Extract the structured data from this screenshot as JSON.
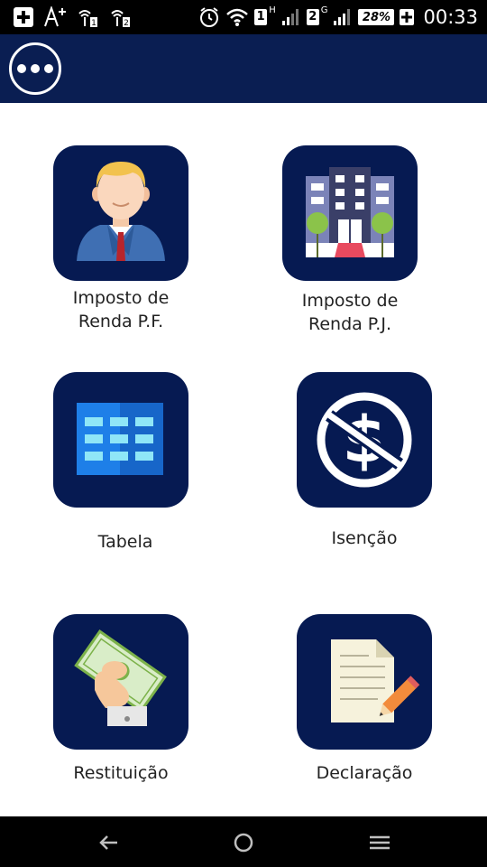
{
  "status_bar": {
    "sim1": "1",
    "sim1_network": "H",
    "sim2": "2",
    "sim2_network": "G",
    "battery": "28%",
    "time": "00:33"
  },
  "appbar": {
    "menu_icon": "more-horizontal-icon",
    "accent": "#0a1e52"
  },
  "menu": {
    "items": [
      {
        "icon": "person-icon",
        "label_lines": [
          "Imposto de",
          "Renda P.F."
        ]
      },
      {
        "icon": "building-icon",
        "label_lines": [
          "Imposto de",
          "Renda P.J."
        ]
      },
      {
        "icon": "table-icon",
        "label_lines": [
          "Tabela"
        ]
      },
      {
        "icon": "no-dollar-icon",
        "label_lines": [
          "Isenção"
        ]
      },
      {
        "icon": "money-hand-icon",
        "label_lines": [
          "Restituição"
        ]
      },
      {
        "icon": "document-pencil-icon",
        "label_lines": [
          "Declaração"
        ]
      }
    ]
  },
  "navbar": {
    "back": "back-icon",
    "home": "home-icon",
    "menu": "menu-icon"
  }
}
